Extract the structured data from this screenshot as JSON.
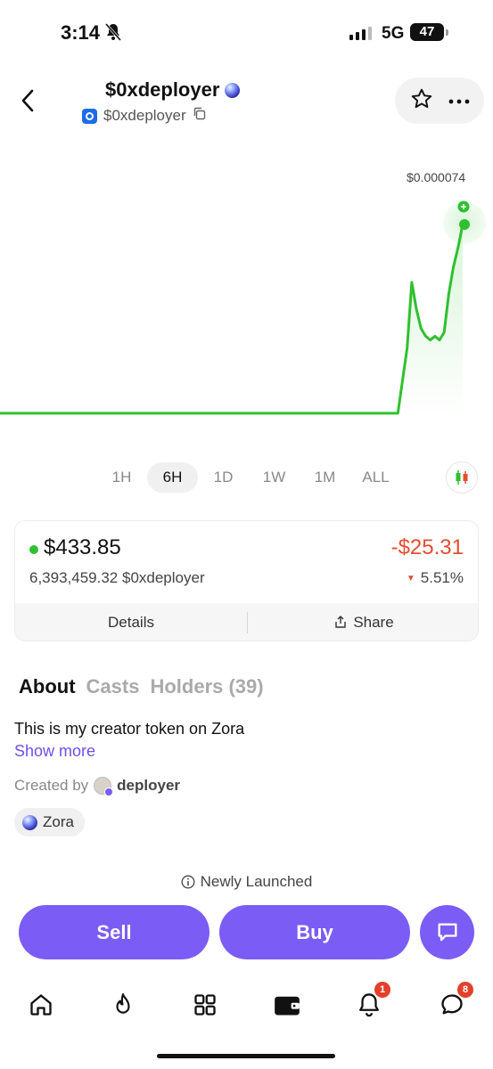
{
  "status_bar": {
    "time": "3:14",
    "network": "5G",
    "battery": "47"
  },
  "header": {
    "title": "$0xdeployer",
    "subtitle": "$0xdeployer"
  },
  "chart": {
    "price_label": "$0.000074",
    "line_color": "#2fc02f"
  },
  "chart_data": {
    "type": "line",
    "title": "",
    "xlabel": "",
    "ylabel": "",
    "x": [
      0,
      10,
      20,
      30,
      40,
      50,
      60,
      70,
      80,
      84,
      86,
      88,
      89,
      90,
      91,
      92,
      93,
      94,
      95,
      96,
      97,
      98,
      99,
      100
    ],
    "values": [
      2.5e-05,
      2.5e-05,
      2.5e-05,
      2.5e-05,
      2.5e-05,
      2.5e-05,
      2.5e-05,
      2.5e-05,
      2.5e-05,
      2.5e-05,
      2.5e-05,
      4.2e-05,
      5.9e-05,
      5.2e-05,
      4.7e-05,
      4.5e-05,
      4.4e-05,
      4.5e-05,
      4.4e-05,
      4.6e-05,
      5.6e-05,
      6.3e-05,
      6.8e-05,
      7.4e-05
    ],
    "last_value": 7.4e-05
  },
  "time_ranges": [
    "1H",
    "6H",
    "1D",
    "1W",
    "1M",
    "ALL"
  ],
  "active_range": "6H",
  "position": {
    "value": "$433.85",
    "change": "-$25.31",
    "holding": "6,393,459.32 $0xdeployer",
    "change_pct": "5.51%",
    "details_label": "Details",
    "share_label": "Share",
    "change_color": "#e34d30"
  },
  "tabs": {
    "about": "About",
    "casts": "Casts",
    "holders": "Holders (39)"
  },
  "about": {
    "description": "This is my creator token on Zora",
    "show_more": "Show more",
    "created_by_label": "Created by",
    "creator": "deployer",
    "platform": "Zora"
  },
  "notice": "Newly Launched",
  "actions": {
    "sell": "Sell",
    "buy": "Buy",
    "accent": "#7b5cf5"
  },
  "bottom_nav": {
    "items": [
      "home-icon",
      "fire-icon",
      "grid-icon",
      "wallet-icon",
      "bell-icon",
      "chat-icon"
    ],
    "notifications_badge": "1",
    "messages_badge": "8"
  }
}
